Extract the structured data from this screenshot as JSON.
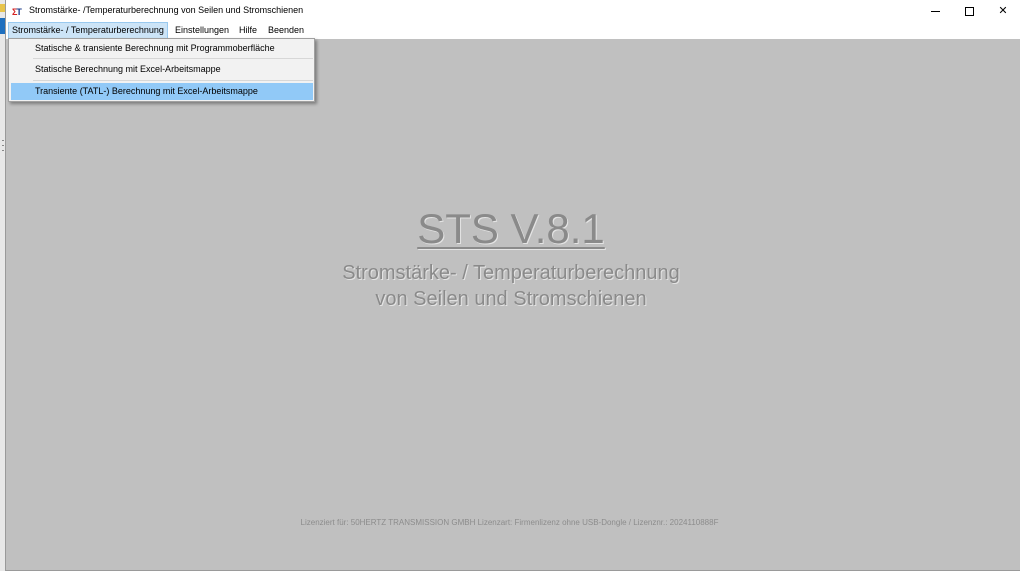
{
  "window": {
    "title": "Stromstärke- /Temperaturberechnung von Seilen und Stromschienen",
    "icon_letters": [
      "Σ",
      "T"
    ],
    "controls": {
      "minimize": "minimize",
      "maximize": "maximize",
      "close": "✕"
    }
  },
  "menubar": {
    "items": [
      {
        "label": "Stromstärke- / Temperaturberechnung",
        "active": true
      },
      {
        "label": "Einstellungen"
      },
      {
        "label": "Hilfe"
      },
      {
        "label": "Beenden"
      }
    ]
  },
  "dropdown": {
    "items": [
      {
        "label": "Statische & transiente Berechnung mit Programmoberfläche"
      },
      {
        "label": "Statische Berechnung mit Excel-Arbeitsmappe"
      },
      {
        "label": "Transiente (TATL-) Berechnung mit Excel-Arbeitsmappe",
        "highlighted": true
      }
    ]
  },
  "splash": {
    "title": "STS V.8.1",
    "subtitle_line1": "Stromstärke- / Temperaturberechnung",
    "subtitle_line2": "von Seilen und Stromschienen",
    "license": "Lizenziert für: 50HERTZ TRANSMISSION GMBH Lizenzart: Firmenlizenz ohne USB-Dongle / Lizenznr.: 2024110888F"
  },
  "colors": {
    "client_bg": "#c0c0c0",
    "menu_active": "#cce4f7",
    "dropdown_highlight": "#91c9f7",
    "splash_text": "#8a8a8a"
  }
}
